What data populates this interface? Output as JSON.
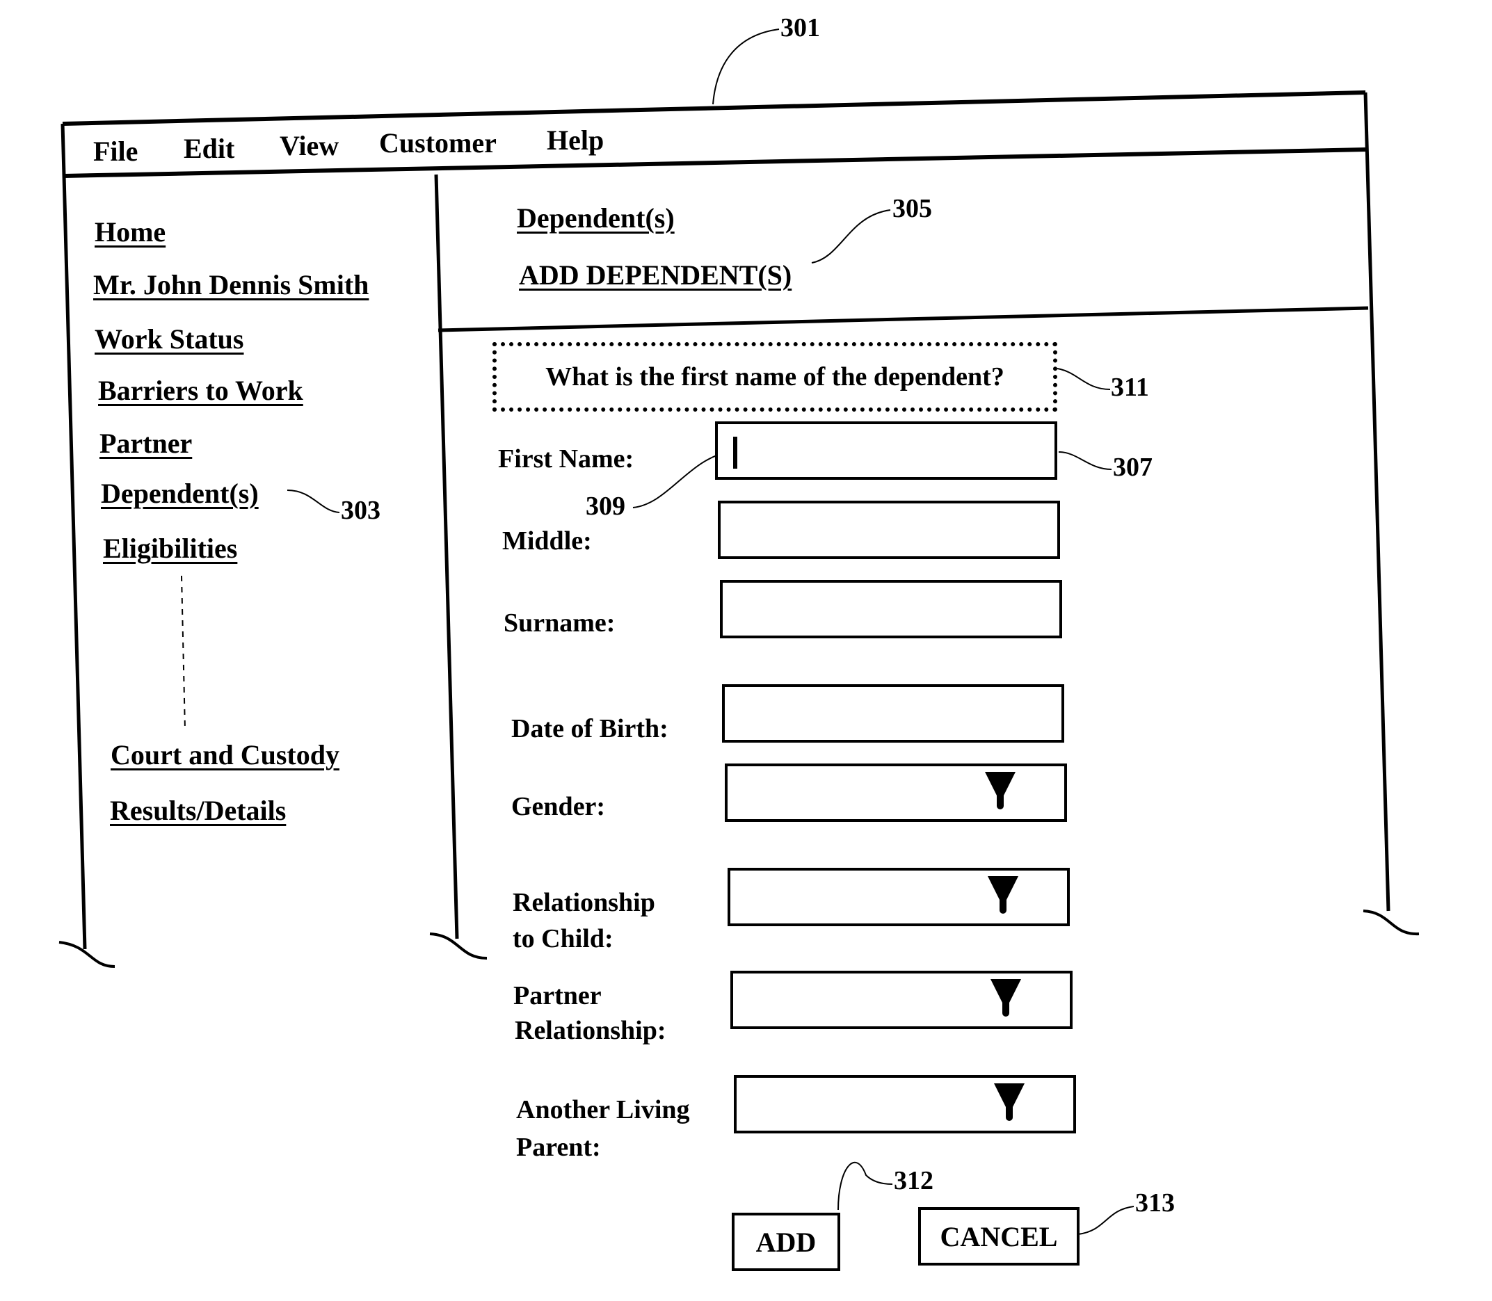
{
  "refs": {
    "window": "301",
    "nav_dependents": "303",
    "add_dependents_header": "305",
    "first_name_field": "307",
    "cursor": "309",
    "prompt": "311",
    "add_button": "312",
    "cancel_button": "313"
  },
  "menu": [
    "File",
    "Edit",
    "View",
    "Customer",
    "Help"
  ],
  "sidebar": {
    "items": [
      {
        "label": "Home"
      },
      {
        "label": "Mr. John Dennis Smith"
      },
      {
        "label": "Work Status"
      },
      {
        "label": "Barriers to Work"
      },
      {
        "label": "Partner"
      },
      {
        "label": "Dependent(s)"
      },
      {
        "label": "Eligibilities"
      },
      {
        "label": "Court and Custody"
      },
      {
        "label": "Results/Details"
      }
    ]
  },
  "header": {
    "breadcrumb": "Dependent(s)",
    "title": "ADD DEPENDENT(S)"
  },
  "form": {
    "prompt": "What is the first name of the dependent?",
    "fields": {
      "first_name": {
        "label": "First Name:",
        "value": ""
      },
      "middle": {
        "label": "Middle:",
        "value": ""
      },
      "surname": {
        "label": "Surname:",
        "value": ""
      },
      "dob": {
        "label": "Date of Birth:",
        "value": ""
      },
      "gender": {
        "label": "Gender:",
        "value": ""
      },
      "relationship_line1": "Relationship",
      "relationship_line2": "to Child:",
      "partner_line1": "Partner",
      "partner_line2": "Relationship:",
      "parent_line1": "Another Living",
      "parent_line2": "Parent:"
    },
    "add_label": "ADD",
    "cancel_label": "CANCEL"
  }
}
